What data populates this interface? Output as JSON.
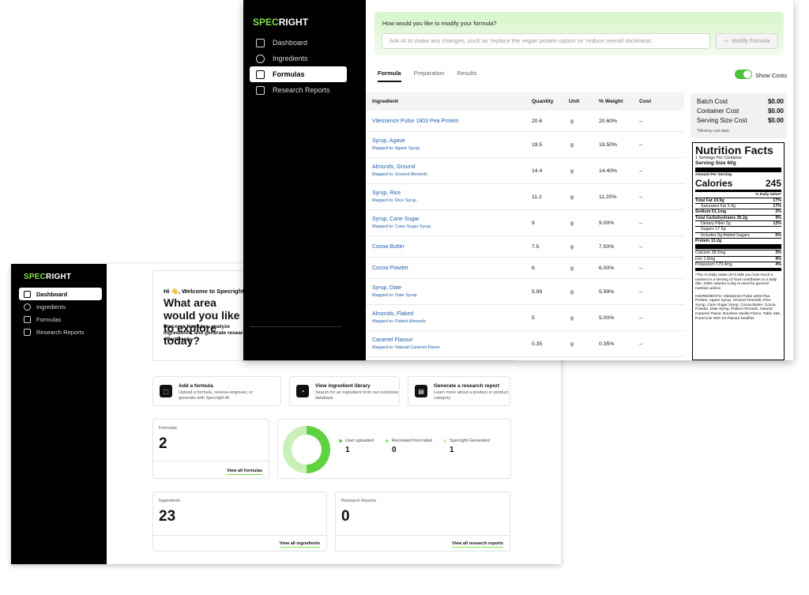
{
  "brand": {
    "prefix": "SPEC",
    "suffix": "RIGHT"
  },
  "back": {
    "nav": [
      "Dashboard",
      "Ingredients",
      "Formulas",
      "Research Reports"
    ],
    "welcome": {
      "greeting": "Hi 👋, Welcome to Specright",
      "question": "What area would you like to explore today?",
      "sub": "Discover formulas, analyze ingredients, and generate research effortlessly."
    },
    "actions": [
      {
        "title": "Add a formula",
        "desc": "Upload a formula, reverse-engineer, or generate with Specright AI"
      },
      {
        "title": "View ingredient library",
        "desc": "Search for an ingredient from our extensive database"
      },
      {
        "title": "Generate a research report",
        "desc": "Learn more about a product or product category"
      }
    ],
    "formulas": {
      "label": "Formulas",
      "count": "2",
      "link": "View all formulas"
    },
    "breakdown": {
      "items": [
        {
          "label": "User uploaded",
          "value": "1",
          "color": "#5ed23f"
        },
        {
          "label": "Recreated from label",
          "value": "0",
          "color": "#9be37e"
        },
        {
          "label": "Specright Generated",
          "value": "1",
          "color": "#c9f0b8"
        }
      ]
    },
    "ingredients": {
      "label": "Ingredients",
      "count": "23",
      "link": "View all ingredients"
    },
    "reports": {
      "label": "Research Reports",
      "count": "0",
      "link": "View all research reports"
    }
  },
  "front": {
    "nav": [
      "Dashboard",
      "Ingredients",
      "Formulas",
      "Research Reports"
    ],
    "ai": {
      "question": "How would you like to modify your formula?",
      "placeholder": "Ask AI to make any changes, such as 'replace the vegan protein option' or 'reduce overall stickiness'.",
      "button": "Modify Formula"
    },
    "tabs": [
      "Formula",
      "Preparation",
      "Results"
    ],
    "show_costs": "Show Costs",
    "columns": [
      "Ingredient",
      "Quantity",
      "Unit",
      "% Weight",
      "Cost"
    ],
    "rows": [
      {
        "name": "Vitessence Pulse 1803 Pea Protein",
        "mapped": "",
        "qty": "20.6",
        "unit": "g",
        "weight": "20.60%",
        "cost": "--"
      },
      {
        "name": "Syrup, Agave",
        "mapped": "Mapped to: Agave Syrup",
        "qty": "19.5",
        "unit": "g",
        "weight": "19.50%",
        "cost": "--"
      },
      {
        "name": "Almonds, Ground",
        "mapped": "Mapped to: Ground Almonds",
        "qty": "14.4",
        "unit": "g",
        "weight": "14.40%",
        "cost": "--"
      },
      {
        "name": "Syrup, Rice",
        "mapped": "Mapped to: Rice Syrup",
        "qty": "11.2",
        "unit": "g",
        "weight": "11.20%",
        "cost": "--"
      },
      {
        "name": "Syrup, Cane Sugar",
        "mapped": "Mapped to: Cane Sugar Syrup",
        "qty": "9",
        "unit": "g",
        "weight": "9.00%",
        "cost": "--"
      },
      {
        "name": "Cocoa Butter",
        "mapped": "",
        "qty": "7.5",
        "unit": "g",
        "weight": "7.50%",
        "cost": "--"
      },
      {
        "name": "Cocoa Powder",
        "mapped": "",
        "qty": "6",
        "unit": "g",
        "weight": "6.00%",
        "cost": "--"
      },
      {
        "name": "Syrup, Date",
        "mapped": "Mapped to: Date Syrup",
        "qty": "5.99",
        "unit": "g",
        "weight": "5.99%",
        "cost": "--"
      },
      {
        "name": "Almonds, Flaked",
        "mapped": "Mapped to: Flaked Almonds",
        "qty": "5",
        "unit": "g",
        "weight": "5.00%",
        "cost": "--"
      },
      {
        "name": "Caramel Flavour",
        "mapped": "Mapped to: Natural Caramel Flavor",
        "qty": "0.35",
        "unit": "g",
        "weight": "0.35%",
        "cost": "--"
      }
    ],
    "costs": [
      {
        "label": "Batch Cost",
        "value": "$0.00"
      },
      {
        "label": "Container Cost",
        "value": "$0.00"
      },
      {
        "label": "Serving Size Cost",
        "value": "$0.00"
      }
    ],
    "cost_note": "*Missing cost data",
    "nutrition": {
      "title": "Nutrition Facts",
      "servings": "1 Servings Per Container",
      "serving_size": "Serving Size 60g",
      "amount_per": "Amount Per Serving",
      "calories_label": "Calories",
      "calories": "245",
      "dv_header": "% Daily Value*",
      "rows": [
        {
          "label": "Total Fat 10.9g",
          "dv": "17%",
          "indent": false,
          "bold": true
        },
        {
          "label": "Saturated Fat 3.4g",
          "dv": "17%",
          "indent": true,
          "bold": false
        },
        {
          "label": "Sodium 51.1mg",
          "dv": "2%",
          "indent": false,
          "bold": true
        },
        {
          "label": "Total Carbohydrates 26.2g",
          "dv": "9%",
          "indent": false,
          "bold": true
        },
        {
          "label": "Dietary Fiber 3g",
          "dv": "12%",
          "indent": true,
          "bold": false
        },
        {
          "label": "Sugars 17.5g",
          "dv": "",
          "indent": true,
          "bold": false
        },
        {
          "label": "Includes 0g Added Sugars",
          "dv": "0%",
          "indent": true,
          "bold": false
        },
        {
          "label": "Protein 13.2g",
          "dv": "",
          "indent": false,
          "bold": true
        }
      ],
      "minerals": [
        {
          "label": "Calcium 38.5mg",
          "dv": "3%"
        },
        {
          "label": "Iron 1.8mg",
          "dv": "9%"
        },
        {
          "label": "Potassium 179.4mg",
          "dv": "4%"
        }
      ],
      "footnote": "*The % Daily Value (DV) tells you how much a nutrient in a serving of food contributes to a daily diet. 2000 calories a day is used for general nutrition advice.",
      "ingredients": "INGREDIENTS: Vitessence Pulse 1803 Pea Protein, Agave Syrup, Ground Almonds, Rice Syrup, Cane Sugar Syrup, Cocoa Butter, Cocoa Powder, Date Syrup, Flaked Almonds, Natural Caramel Flavor, Bourbon Vanilla Flavor, Table Salt, Purecircle NSF-04 Flavour Modifier"
    }
  }
}
